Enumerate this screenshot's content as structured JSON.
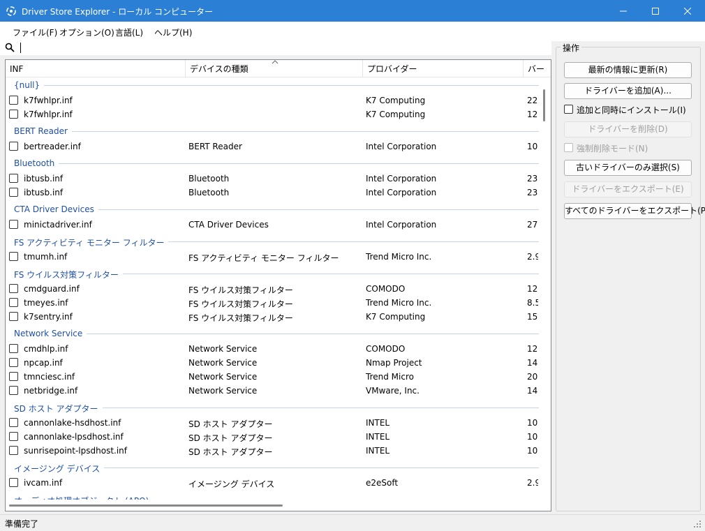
{
  "window": {
    "title": "Driver Store Explorer - ローカル コンピューター"
  },
  "menu": [
    "ファイル(F)",
    "オプション(O)",
    "言語(L)",
    "ヘルプ(H)"
  ],
  "search": {
    "value": ""
  },
  "columns": [
    "INF",
    "デバイスの種類",
    "プロバイダー",
    "バー"
  ],
  "groups": [
    {
      "name": "{null}",
      "rows": [
        {
          "inf": "k7fwhlpr.inf",
          "device": "",
          "provider": "K7 Computing",
          "ver": "22."
        },
        {
          "inf": "k7fwhlpr.inf",
          "device": "",
          "provider": "K7 Computing",
          "ver": "12."
        }
      ]
    },
    {
      "name": "BERT Reader",
      "rows": [
        {
          "inf": "bertreader.inf",
          "device": "BERT Reader",
          "provider": "Intel Corporation",
          "ver": "10."
        }
      ]
    },
    {
      "name": "Bluetooth",
      "rows": [
        {
          "inf": "ibtusb.inf",
          "device": "Bluetooth",
          "provider": "Intel Corporation",
          "ver": "23."
        },
        {
          "inf": "ibtusb.inf",
          "device": "Bluetooth",
          "provider": "Intel Corporation",
          "ver": "23."
        }
      ]
    },
    {
      "name": "CTA Driver Devices",
      "rows": [
        {
          "inf": "minictadriver.inf",
          "device": "CTA Driver Devices",
          "provider": "Intel Corporation",
          "ver": "27."
        }
      ]
    },
    {
      "name": "FS アクティビティ モニター フィルター",
      "rows": [
        {
          "inf": "tmumh.inf",
          "device": "FS アクティビティ モニター フィルター",
          "provider": "Trend Micro Inc.",
          "ver": "2.9"
        }
      ]
    },
    {
      "name": "FS ウイルス対策フィルター",
      "rows": [
        {
          "inf": "cmdguard.inf",
          "device": "FS ウイルス対策フィルター",
          "provider": "COMODO",
          "ver": "12."
        },
        {
          "inf": "tmeyes.inf",
          "device": "FS ウイルス対策フィルター",
          "provider": "Trend Micro Inc.",
          "ver": "8.5"
        },
        {
          "inf": "k7sentry.inf",
          "device": "FS ウイルス対策フィルター",
          "provider": "K7 Computing",
          "ver": "15."
        }
      ]
    },
    {
      "name": "Network Service",
      "rows": [
        {
          "inf": "cmdhlp.inf",
          "device": "Network Service",
          "provider": "COMODO",
          "ver": "12."
        },
        {
          "inf": "npcap.inf",
          "device": "Network Service",
          "provider": "Nmap Project",
          "ver": "14."
        },
        {
          "inf": "tmnciesc.inf",
          "device": "Network Service",
          "provider": "Trend Micro",
          "ver": "20."
        },
        {
          "inf": "netbridge.inf",
          "device": "Network Service",
          "provider": "VMware, Inc.",
          "ver": "14."
        }
      ]
    },
    {
      "name": "SD ホスト アダプター",
      "rows": [
        {
          "inf": "cannonlake-hsdhost.inf",
          "device": "SD ホスト アダプター",
          "provider": "INTEL",
          "ver": "10."
        },
        {
          "inf": "cannonlake-lpsdhost.inf",
          "device": "SD ホスト アダプター",
          "provider": "INTEL",
          "ver": "10."
        },
        {
          "inf": "sunrisepoint-lpsdhost.inf",
          "device": "SD ホスト アダプター",
          "provider": "INTEL",
          "ver": "10."
        }
      ]
    },
    {
      "name": "イメージング デバイス",
      "rows": [
        {
          "inf": "ivcam.inf",
          "device": "イメージング デバイス",
          "provider": "e2eSoft",
          "ver": "2.9"
        }
      ]
    },
    {
      "name": "オーディオ処理オブジェクト (APO)",
      "rows": []
    }
  ],
  "operations": {
    "title": "操作",
    "refresh": "最新の情報に更新(R)",
    "add_driver": "ドライバーを追加(A)...",
    "install_on_add": "追加と同時にインストール(I)",
    "delete_driver": "ドライバーを削除(D)",
    "force_delete": "強制削除モード(N)",
    "select_old": "古いドライバーのみ選択(S)",
    "export_driver": "ドライバーをエクスポート(E)",
    "export_all": "すべてのドライバーをエクスポート(P)..."
  },
  "status": {
    "text": "準備完了"
  },
  "colors": {
    "titlebar": "#2b7fd4",
    "group_text": "#1e4fa8",
    "group_line": "#c6d4e6"
  },
  "icons": [
    "app-icon",
    "minimize-icon",
    "maximize-icon",
    "close-icon",
    "search-icon",
    "sort-ascending-icon",
    "resize-grip-icon"
  ]
}
